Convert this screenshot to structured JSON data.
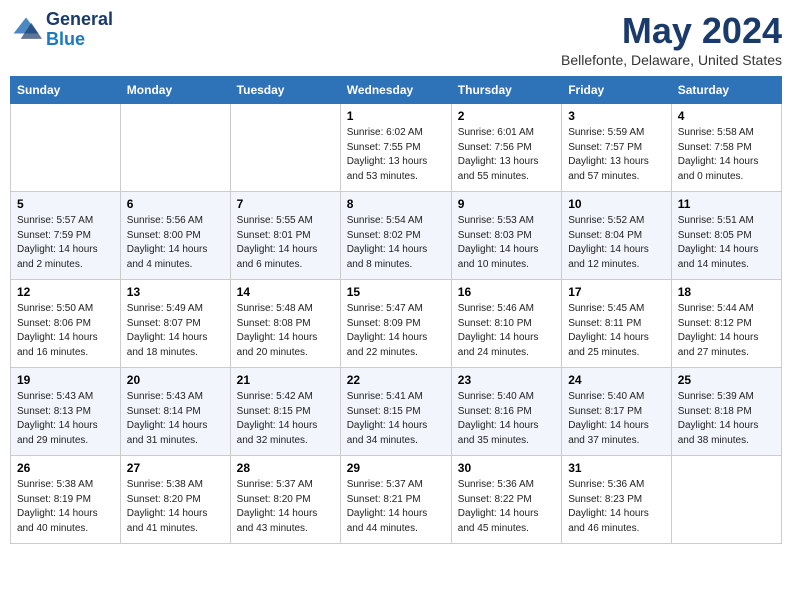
{
  "header": {
    "logo_line1": "General",
    "logo_line2": "Blue",
    "month_title": "May 2024",
    "location": "Bellefonte, Delaware, United States"
  },
  "days_of_week": [
    "Sunday",
    "Monday",
    "Tuesday",
    "Wednesday",
    "Thursday",
    "Friday",
    "Saturday"
  ],
  "weeks": [
    [
      {
        "day": "",
        "info": ""
      },
      {
        "day": "",
        "info": ""
      },
      {
        "day": "",
        "info": ""
      },
      {
        "day": "1",
        "info": "Sunrise: 6:02 AM\nSunset: 7:55 PM\nDaylight: 13 hours\nand 53 minutes."
      },
      {
        "day": "2",
        "info": "Sunrise: 6:01 AM\nSunset: 7:56 PM\nDaylight: 13 hours\nand 55 minutes."
      },
      {
        "day": "3",
        "info": "Sunrise: 5:59 AM\nSunset: 7:57 PM\nDaylight: 13 hours\nand 57 minutes."
      },
      {
        "day": "4",
        "info": "Sunrise: 5:58 AM\nSunset: 7:58 PM\nDaylight: 14 hours\nand 0 minutes."
      }
    ],
    [
      {
        "day": "5",
        "info": "Sunrise: 5:57 AM\nSunset: 7:59 PM\nDaylight: 14 hours\nand 2 minutes."
      },
      {
        "day": "6",
        "info": "Sunrise: 5:56 AM\nSunset: 8:00 PM\nDaylight: 14 hours\nand 4 minutes."
      },
      {
        "day": "7",
        "info": "Sunrise: 5:55 AM\nSunset: 8:01 PM\nDaylight: 14 hours\nand 6 minutes."
      },
      {
        "day": "8",
        "info": "Sunrise: 5:54 AM\nSunset: 8:02 PM\nDaylight: 14 hours\nand 8 minutes."
      },
      {
        "day": "9",
        "info": "Sunrise: 5:53 AM\nSunset: 8:03 PM\nDaylight: 14 hours\nand 10 minutes."
      },
      {
        "day": "10",
        "info": "Sunrise: 5:52 AM\nSunset: 8:04 PM\nDaylight: 14 hours\nand 12 minutes."
      },
      {
        "day": "11",
        "info": "Sunrise: 5:51 AM\nSunset: 8:05 PM\nDaylight: 14 hours\nand 14 minutes."
      }
    ],
    [
      {
        "day": "12",
        "info": "Sunrise: 5:50 AM\nSunset: 8:06 PM\nDaylight: 14 hours\nand 16 minutes."
      },
      {
        "day": "13",
        "info": "Sunrise: 5:49 AM\nSunset: 8:07 PM\nDaylight: 14 hours\nand 18 minutes."
      },
      {
        "day": "14",
        "info": "Sunrise: 5:48 AM\nSunset: 8:08 PM\nDaylight: 14 hours\nand 20 minutes."
      },
      {
        "day": "15",
        "info": "Sunrise: 5:47 AM\nSunset: 8:09 PM\nDaylight: 14 hours\nand 22 minutes."
      },
      {
        "day": "16",
        "info": "Sunrise: 5:46 AM\nSunset: 8:10 PM\nDaylight: 14 hours\nand 24 minutes."
      },
      {
        "day": "17",
        "info": "Sunrise: 5:45 AM\nSunset: 8:11 PM\nDaylight: 14 hours\nand 25 minutes."
      },
      {
        "day": "18",
        "info": "Sunrise: 5:44 AM\nSunset: 8:12 PM\nDaylight: 14 hours\nand 27 minutes."
      }
    ],
    [
      {
        "day": "19",
        "info": "Sunrise: 5:43 AM\nSunset: 8:13 PM\nDaylight: 14 hours\nand 29 minutes."
      },
      {
        "day": "20",
        "info": "Sunrise: 5:43 AM\nSunset: 8:14 PM\nDaylight: 14 hours\nand 31 minutes."
      },
      {
        "day": "21",
        "info": "Sunrise: 5:42 AM\nSunset: 8:15 PM\nDaylight: 14 hours\nand 32 minutes."
      },
      {
        "day": "22",
        "info": "Sunrise: 5:41 AM\nSunset: 8:15 PM\nDaylight: 14 hours\nand 34 minutes."
      },
      {
        "day": "23",
        "info": "Sunrise: 5:40 AM\nSunset: 8:16 PM\nDaylight: 14 hours\nand 35 minutes."
      },
      {
        "day": "24",
        "info": "Sunrise: 5:40 AM\nSunset: 8:17 PM\nDaylight: 14 hours\nand 37 minutes."
      },
      {
        "day": "25",
        "info": "Sunrise: 5:39 AM\nSunset: 8:18 PM\nDaylight: 14 hours\nand 38 minutes."
      }
    ],
    [
      {
        "day": "26",
        "info": "Sunrise: 5:38 AM\nSunset: 8:19 PM\nDaylight: 14 hours\nand 40 minutes."
      },
      {
        "day": "27",
        "info": "Sunrise: 5:38 AM\nSunset: 8:20 PM\nDaylight: 14 hours\nand 41 minutes."
      },
      {
        "day": "28",
        "info": "Sunrise: 5:37 AM\nSunset: 8:20 PM\nDaylight: 14 hours\nand 43 minutes."
      },
      {
        "day": "29",
        "info": "Sunrise: 5:37 AM\nSunset: 8:21 PM\nDaylight: 14 hours\nand 44 minutes."
      },
      {
        "day": "30",
        "info": "Sunrise: 5:36 AM\nSunset: 8:22 PM\nDaylight: 14 hours\nand 45 minutes."
      },
      {
        "day": "31",
        "info": "Sunrise: 5:36 AM\nSunset: 8:23 PM\nDaylight: 14 hours\nand 46 minutes."
      },
      {
        "day": "",
        "info": ""
      }
    ]
  ]
}
